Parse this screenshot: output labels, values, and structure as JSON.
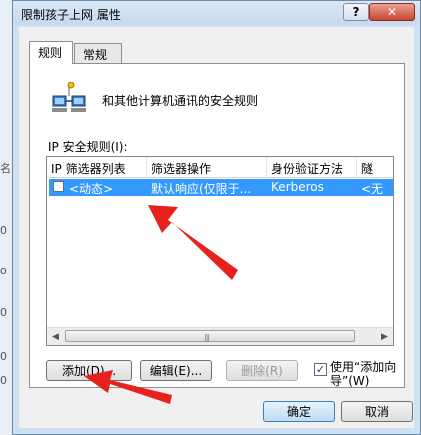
{
  "window": {
    "title": "限制孩子上网 属性"
  },
  "titlebar": {
    "help_glyph": "?",
    "close_glyph": "✕"
  },
  "tabs": [
    {
      "label": "规则",
      "active": true
    },
    {
      "label": "常规",
      "active": false
    }
  ],
  "panel": {
    "heading": "和其他计算机通讯的安全规则",
    "list_label": "IP 安全规则(I):"
  },
  "rules_list": {
    "columns": [
      "IP 筛选器列表",
      "筛选器操作",
      "身份验证方法",
      "隧"
    ],
    "rows": [
      {
        "checked": false,
        "filter_list": "<动态>",
        "filter_action": "默认响应(仅限于...",
        "auth": "Kerberos",
        "tunnel": "<无"
      }
    ]
  },
  "buttons": {
    "add": "添加(D)...",
    "edit": "编辑(E)...",
    "delete": "删除(R)",
    "ok": "确定",
    "cancel": "取消"
  },
  "wizard": {
    "checked": true,
    "label": "使用“添加向导”(W)"
  },
  "icons": [
    "network-computers-icon",
    "help-icon",
    "close-icon",
    "scroll-left-icon",
    "scroll-right-icon",
    "red-arrow-annotation"
  ],
  "colors": {
    "selection": "#3399ff",
    "annotation": "#e8211c"
  }
}
